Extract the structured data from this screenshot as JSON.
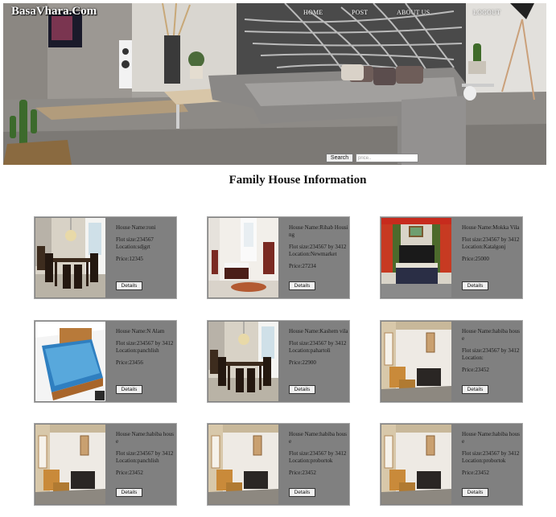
{
  "site": {
    "brand": "BasaVhara.Com"
  },
  "nav": [
    {
      "label": "HOME"
    },
    {
      "label": "POST"
    },
    {
      "label": "ABOUT US"
    },
    {
      "label": "LOGOUT"
    }
  ],
  "search": {
    "button_label": "Search",
    "placeholder": "price.."
  },
  "page_title": "Family House Information",
  "details_label": "Details",
  "houses": [
    {
      "image": "dining-room",
      "name": "House Name:roni",
      "size": "Flot size:234567",
      "location": "Location:sdjgrt",
      "price": "Price:12345"
    },
    {
      "image": "bedroom-white",
      "name": "House Name:Rihab Housing",
      "size": "Flot size:234567 by 3412",
      "location": "Location:Newmarket",
      "price": "Price:27234"
    },
    {
      "image": "bedroom-curtains",
      "name": "House Name:Mokka Vila",
      "size": "Flot size:234567 by 3412",
      "location": "Location:Katalgonj",
      "price": "Price:25000"
    },
    {
      "image": "blue-bed",
      "name": "House Name:N Alam",
      "size": "Flot size:234567 by 3412",
      "location": "Location:panchlish",
      "price": "Price:23456"
    },
    {
      "image": "dining-room",
      "name": "House Name:Kashem vila",
      "size": "Flot size:234567 by 3412",
      "location": "Location:pahartoli",
      "price": "Price:22900"
    },
    {
      "image": "room-sofa",
      "name": "House Name:habiba house",
      "size": "Flot size:234567 by 3412",
      "location": "Location:",
      "price": "Price:23452"
    },
    {
      "image": "room-sofa",
      "name": "House Name:habiba house",
      "size": "Flot size:234567 by 3412",
      "location": "Location:panchlish",
      "price": "Price:23452"
    },
    {
      "image": "room-sofa",
      "name": "House Name:habiba house",
      "size": "Flot size:234567 by 3412",
      "location": "Location:probortok",
      "price": "Price:23452"
    },
    {
      "image": "room-sofa",
      "name": "House Name:habiba house",
      "size": "Flot size:234567 by 3412",
      "location": "Location:probortok",
      "price": "Price:23452"
    }
  ]
}
